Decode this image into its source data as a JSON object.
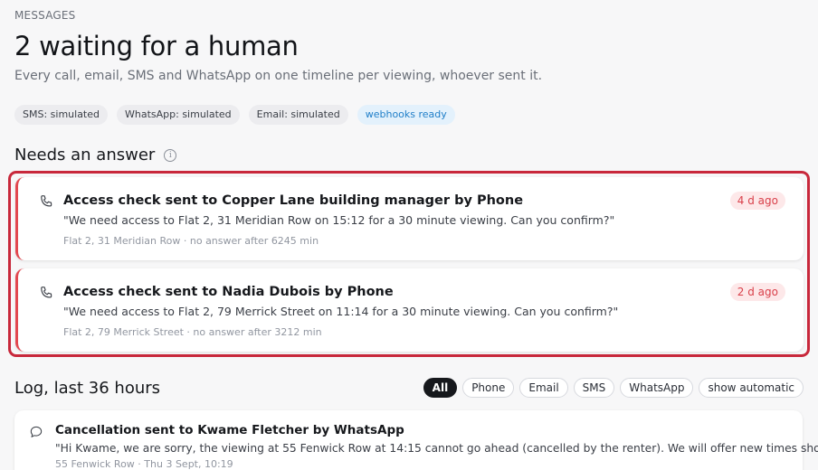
{
  "header": {
    "eyebrow": "MESSAGES",
    "title": "2 waiting for a human",
    "subtitle": "Every call, email, SMS and WhatsApp on one timeline per viewing, whoever sent it."
  },
  "chips": [
    {
      "label": "SMS: simulated"
    },
    {
      "label": "WhatsApp: simulated"
    },
    {
      "label": "Email: simulated"
    },
    {
      "label": "webhooks ready"
    }
  ],
  "needs_answer": {
    "title": "Needs an answer",
    "items": [
      {
        "channel_icon": "phone-icon",
        "title": "Access check sent to Copper Lane building manager by Phone",
        "quote": "\"We need access to Flat 2, 31 Meridian Row on 15:12 for a 30 minute viewing. Can you confirm?\"",
        "meta": "Flat 2, 31 Meridian Row · no answer after 6245 min",
        "age": "4 d ago"
      },
      {
        "channel_icon": "phone-icon",
        "title": "Access check sent to Nadia Dubois by Phone",
        "quote": "\"We need access to Flat 2, 79 Merrick Street on 11:14 for a 30 minute viewing. Can you confirm?\"",
        "meta": "Flat 2, 79 Merrick Street · no answer after 3212 min",
        "age": "2 d ago"
      }
    ]
  },
  "log": {
    "title": "Log, last 36 hours",
    "filters": [
      {
        "label": "All",
        "active": true
      },
      {
        "label": "Phone",
        "active": false
      },
      {
        "label": "Email",
        "active": false
      },
      {
        "label": "SMS",
        "active": false
      },
      {
        "label": "WhatsApp",
        "active": false
      },
      {
        "label": "show automatic",
        "active": false
      }
    ],
    "items": [
      {
        "channel_icon": "chat-bubble-icon",
        "title": "Cancellation sent to Kwame Fletcher by WhatsApp",
        "quote": "\"Hi Kwame, we are sorry, the viewing at 55 Fenwick Row at 14:15 cannot go ahead (cancelled by the renter). We will offer new times shortly.\"",
        "meta": "55 Fenwick Row · Thu 3 Sept, 10:19"
      }
    ]
  },
  "colors": {
    "accent_red": "#e2474f",
    "highlight_frame": "#c8283b",
    "webhooks_chip": "#1f7ec8",
    "active_filter": "#16181c"
  }
}
